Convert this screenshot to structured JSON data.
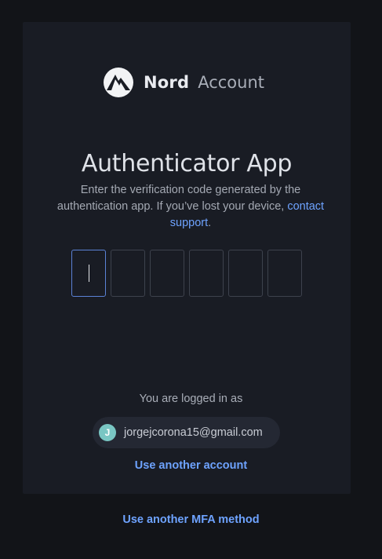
{
  "brand": {
    "name": "Nord",
    "product": "Account"
  },
  "auth": {
    "title": "Authenticator App",
    "description": "Enter the verification code generated by the authentication app. If you’ve lost your device,",
    "support_link": "contact support",
    "support_suffix": ".",
    "code_digits": [
      "",
      "",
      "",
      "",
      "",
      ""
    ]
  },
  "session": {
    "logged_in_label": "You are logged in as",
    "avatar_initial": "J",
    "email": "jorgejcorona15@gmail.com",
    "another_account_link": "Use another account"
  },
  "footer": {
    "mfa_link": "Use another MFA method"
  },
  "colors": {
    "background": "#121418",
    "card": "#191c24",
    "link": "#6ea3ff",
    "avatar": "#79c6c3",
    "active_border": "#5b82d6"
  }
}
